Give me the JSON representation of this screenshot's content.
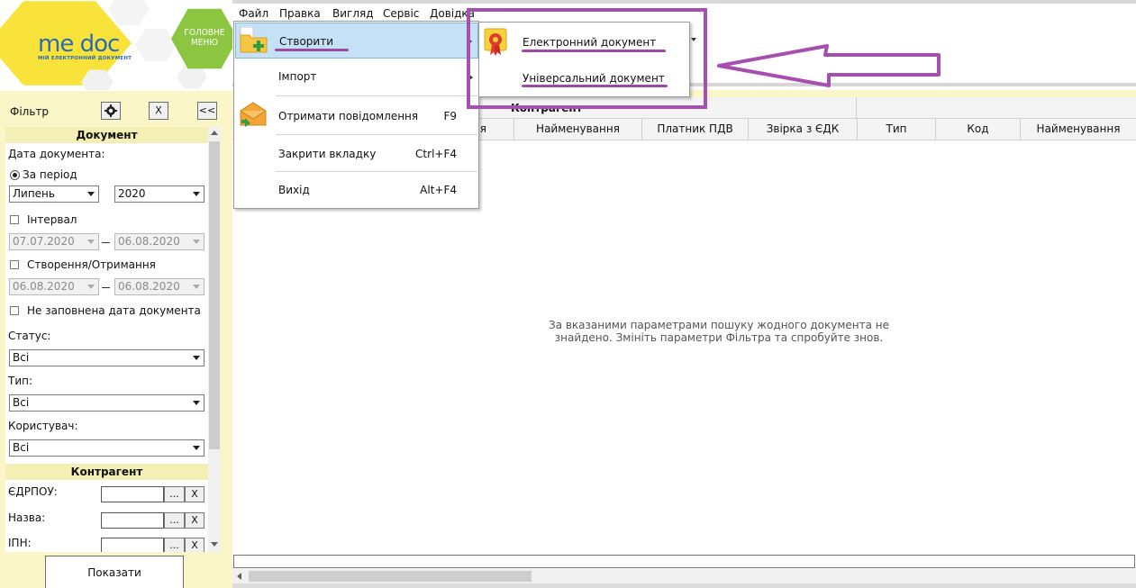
{
  "logo": {
    "brand": "me doc",
    "tagline": "МІЙ ЕЛЕКТРОННИЙ ДОКУМЕНТ",
    "main_menu": "ГОЛОВНЕ МЕНЮ",
    "accent_green": "#8cc540",
    "accent_yellow": "#f9e33a",
    "brand_blue": "#2b6cb0"
  },
  "menubar": {
    "items": [
      "Файл",
      "Правка",
      "Вигляд",
      "Сервіс",
      "Довідка"
    ]
  },
  "file_menu": {
    "items": [
      {
        "label": "Створити",
        "shortcut": "",
        "icon": "folder-add-icon",
        "submenu": true
      },
      {
        "label": "Імпорт",
        "shortcut": "",
        "icon": "",
        "submenu": true
      },
      {
        "label": "Отримати повідомлення",
        "shortcut": "F9",
        "icon": "envelope-download-icon",
        "submenu": false
      },
      {
        "label": "Закрити вкладку",
        "shortcut": "Ctrl+F4",
        "icon": "",
        "submenu": false
      },
      {
        "label": "Вихід",
        "shortcut": "Alt+F4",
        "icon": "",
        "submenu": false
      }
    ]
  },
  "create_submenu": {
    "items": [
      {
        "label": "Електронний документ",
        "icon": "certificate-icon"
      },
      {
        "label": "Універсальний документ",
        "icon": ""
      }
    ]
  },
  "filter": {
    "title": "Фільтр",
    "clear_label": "X",
    "collapse_label": "<<",
    "document_section": "Документ",
    "doc_date_label": "Дата документа:",
    "period_label": "За період",
    "month_value": "Липень",
    "year_value": "2020",
    "interval_label": "Інтервал",
    "interval_from": "07.07.2020",
    "interval_to": "06.08.2020",
    "created_label": "Створення/Отримання",
    "created_from": "06.08.2020",
    "created_to": "06.08.2020",
    "no_date_label": "Не заповнена дата документа",
    "status_label": "Статус:",
    "status_value": "Всі",
    "type_label": "Тип:",
    "type_value": "Всі",
    "user_label": "Користувач:",
    "user_value": "Всі",
    "counterparty_section": "Контрагент",
    "edrpou_label": "ЄДРПОУ:",
    "name_label": "Назва:",
    "ipn_label": "ІПН:",
    "ellipsis": "...",
    "x": "X",
    "show_button": "Показати"
  },
  "grid": {
    "group_label": "Контрагент",
    "columns": [
      "я",
      "Найменування",
      "Платник ПДВ",
      "Звірка з ЄДК",
      "Тип",
      "Код",
      "Найменування"
    ],
    "empty_message_line1": "За вказаними параметрами пошуку жодного документа не",
    "empty_message_line2": "знайдено. Змініть параметри Фільтра та спробуйте знов."
  },
  "annotation": {
    "color": "#a64fb0"
  }
}
